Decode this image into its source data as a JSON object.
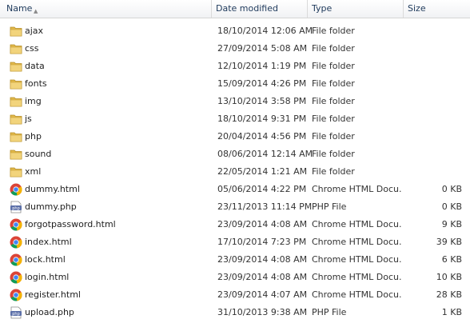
{
  "columns": {
    "name": "Name",
    "date": "Date modified",
    "type": "Type",
    "size": "Size"
  },
  "files": [
    {
      "name": "ajax",
      "date": "18/10/2014 12:06 AM",
      "type": "File folder",
      "size": "",
      "icon": "folder-icon"
    },
    {
      "name": "css",
      "date": "27/09/2014 5:08 AM",
      "type": "File folder",
      "size": "",
      "icon": "folder-icon"
    },
    {
      "name": "data",
      "date": "12/10/2014 1:19 PM",
      "type": "File folder",
      "size": "",
      "icon": "folder-icon"
    },
    {
      "name": "fonts",
      "date": "15/09/2014 4:26 PM",
      "type": "File folder",
      "size": "",
      "icon": "folder-icon"
    },
    {
      "name": "img",
      "date": "13/10/2014 3:58 PM",
      "type": "File folder",
      "size": "",
      "icon": "folder-icon"
    },
    {
      "name": "js",
      "date": "18/10/2014 9:31 PM",
      "type": "File folder",
      "size": "",
      "icon": "folder-icon"
    },
    {
      "name": "php",
      "date": "20/04/2014 4:56 PM",
      "type": "File folder",
      "size": "",
      "icon": "folder-icon"
    },
    {
      "name": "sound",
      "date": "08/06/2014 12:14 AM",
      "type": "File folder",
      "size": "",
      "icon": "folder-icon"
    },
    {
      "name": "xml",
      "date": "22/05/2014 1:21 AM",
      "type": "File folder",
      "size": "",
      "icon": "folder-icon"
    },
    {
      "name": "dummy.html",
      "date": "05/06/2014 4:22 PM",
      "type": "Chrome HTML Docu...",
      "size": "0 KB",
      "icon": "chrome-icon"
    },
    {
      "name": "dummy.php",
      "date": "23/11/2013 11:14 PM",
      "type": "PHP File",
      "size": "0 KB",
      "icon": "php-file-icon"
    },
    {
      "name": "forgotpassword.html",
      "date": "23/09/2014 4:08 AM",
      "type": "Chrome HTML Docu...",
      "size": "9 KB",
      "icon": "chrome-icon"
    },
    {
      "name": "index.html",
      "date": "17/10/2014 7:23 PM",
      "type": "Chrome HTML Docu...",
      "size": "39 KB",
      "icon": "chrome-icon"
    },
    {
      "name": "lock.html",
      "date": "23/09/2014 4:08 AM",
      "type": "Chrome HTML Docu...",
      "size": "6 KB",
      "icon": "chrome-icon"
    },
    {
      "name": "login.html",
      "date": "23/09/2014 4:08 AM",
      "type": "Chrome HTML Docu...",
      "size": "10 KB",
      "icon": "chrome-icon"
    },
    {
      "name": "register.html",
      "date": "23/09/2014 4:07 AM",
      "type": "Chrome HTML Docu...",
      "size": "28 KB",
      "icon": "chrome-icon"
    },
    {
      "name": "upload.php",
      "date": "31/10/2013 9:38 AM",
      "type": "PHP File",
      "size": "1 KB",
      "icon": "php-file-icon"
    }
  ],
  "colors": {
    "folder": "#e8c35a",
    "header_text": "#1e395b",
    "row_text": "#1e1e1e"
  }
}
